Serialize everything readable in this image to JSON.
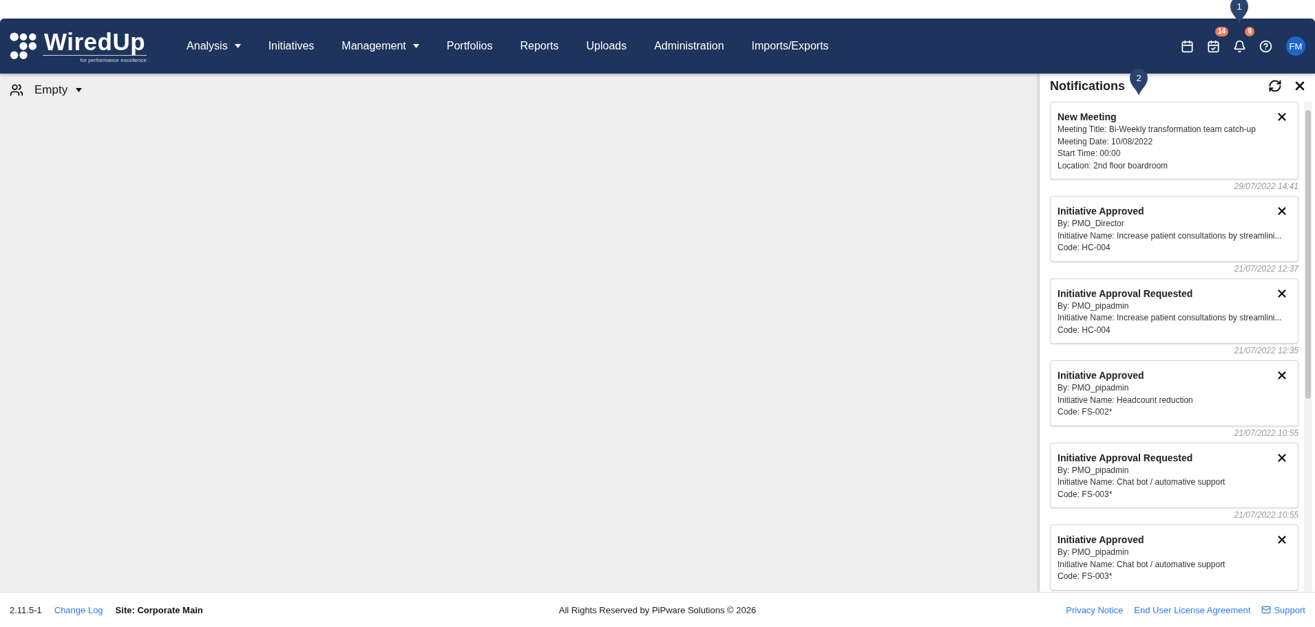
{
  "header": {
    "logo": {
      "name": "WiredUp",
      "tagline": "for performance excellence"
    },
    "nav": [
      {
        "label": "Analysis",
        "dropdown": true
      },
      {
        "label": "Initiatives",
        "dropdown": false
      },
      {
        "label": "Management",
        "dropdown": true
      },
      {
        "label": "Portfolios",
        "dropdown": false
      },
      {
        "label": "Reports",
        "dropdown": false
      },
      {
        "label": "Uploads",
        "dropdown": false
      },
      {
        "label": "Administration",
        "dropdown": false
      },
      {
        "label": "Imports/Exports",
        "dropdown": false
      }
    ],
    "actions": [
      {
        "kind": "calendar"
      },
      {
        "kind": "tasks",
        "badge": "14"
      },
      {
        "kind": "notifications",
        "badge": "9",
        "marker": "1"
      },
      {
        "kind": "help"
      }
    ],
    "avatar": "FM"
  },
  "toolbar": {
    "group_selector": "Empty"
  },
  "notifications": {
    "title": "Notifications",
    "marker": "2",
    "items": [
      {
        "title": "New Meeting",
        "lines": [
          "Meeting Title: Bi-Weekly transformation team catch-up",
          "Meeting Date: 10/08/2022",
          "Start Time: 00:00",
          "Location: 2nd floor boardroom"
        ],
        "time": "29/07/2022 14:41"
      },
      {
        "title": "Initiative Approved",
        "lines": [
          "By: PMO_Director",
          "Initiative Name: Increase patient consultations by streamlini...",
          "Code: HC-004"
        ],
        "time": "21/07/2022 12:37"
      },
      {
        "title": "Initiative Approval Requested",
        "lines": [
          "By: PMO_pipadmin",
          "Initiative Name: Increase patient consultations by streamlini...",
          "Code: HC-004"
        ],
        "time": "21/07/2022 12:35"
      },
      {
        "title": "Initiative Approved",
        "lines": [
          "By: PMO_pipadmin",
          "Initiative Name: Headcount reduction",
          "Code: FS-002*"
        ],
        "time": "21/07/2022 10:55"
      },
      {
        "title": "Initiative Approval Requested",
        "lines": [
          "By: PMO_pipadmin",
          "Initiative Name: Chat bot / automative support",
          "Code: FS-003*"
        ],
        "time": "21/07/2022 10:55"
      },
      {
        "title": "Initiative Approved",
        "lines": [
          "By: PMO_pipadmin",
          "Initiative Name: Chat bot / automative support",
          "Code: FS-003*"
        ]
      }
    ]
  },
  "footer": {
    "version": "2.11.5-1",
    "change_log": "Change Log",
    "site": "Site: Corporate Main",
    "copyright": "All Rights Reserved by PiPware Solutions © 2026",
    "links": [
      {
        "label": "Privacy Notice",
        "kind": "plain"
      },
      {
        "label": "End User License Agreement",
        "kind": "plain"
      },
      {
        "label": "Support",
        "kind": "support"
      }
    ]
  }
}
